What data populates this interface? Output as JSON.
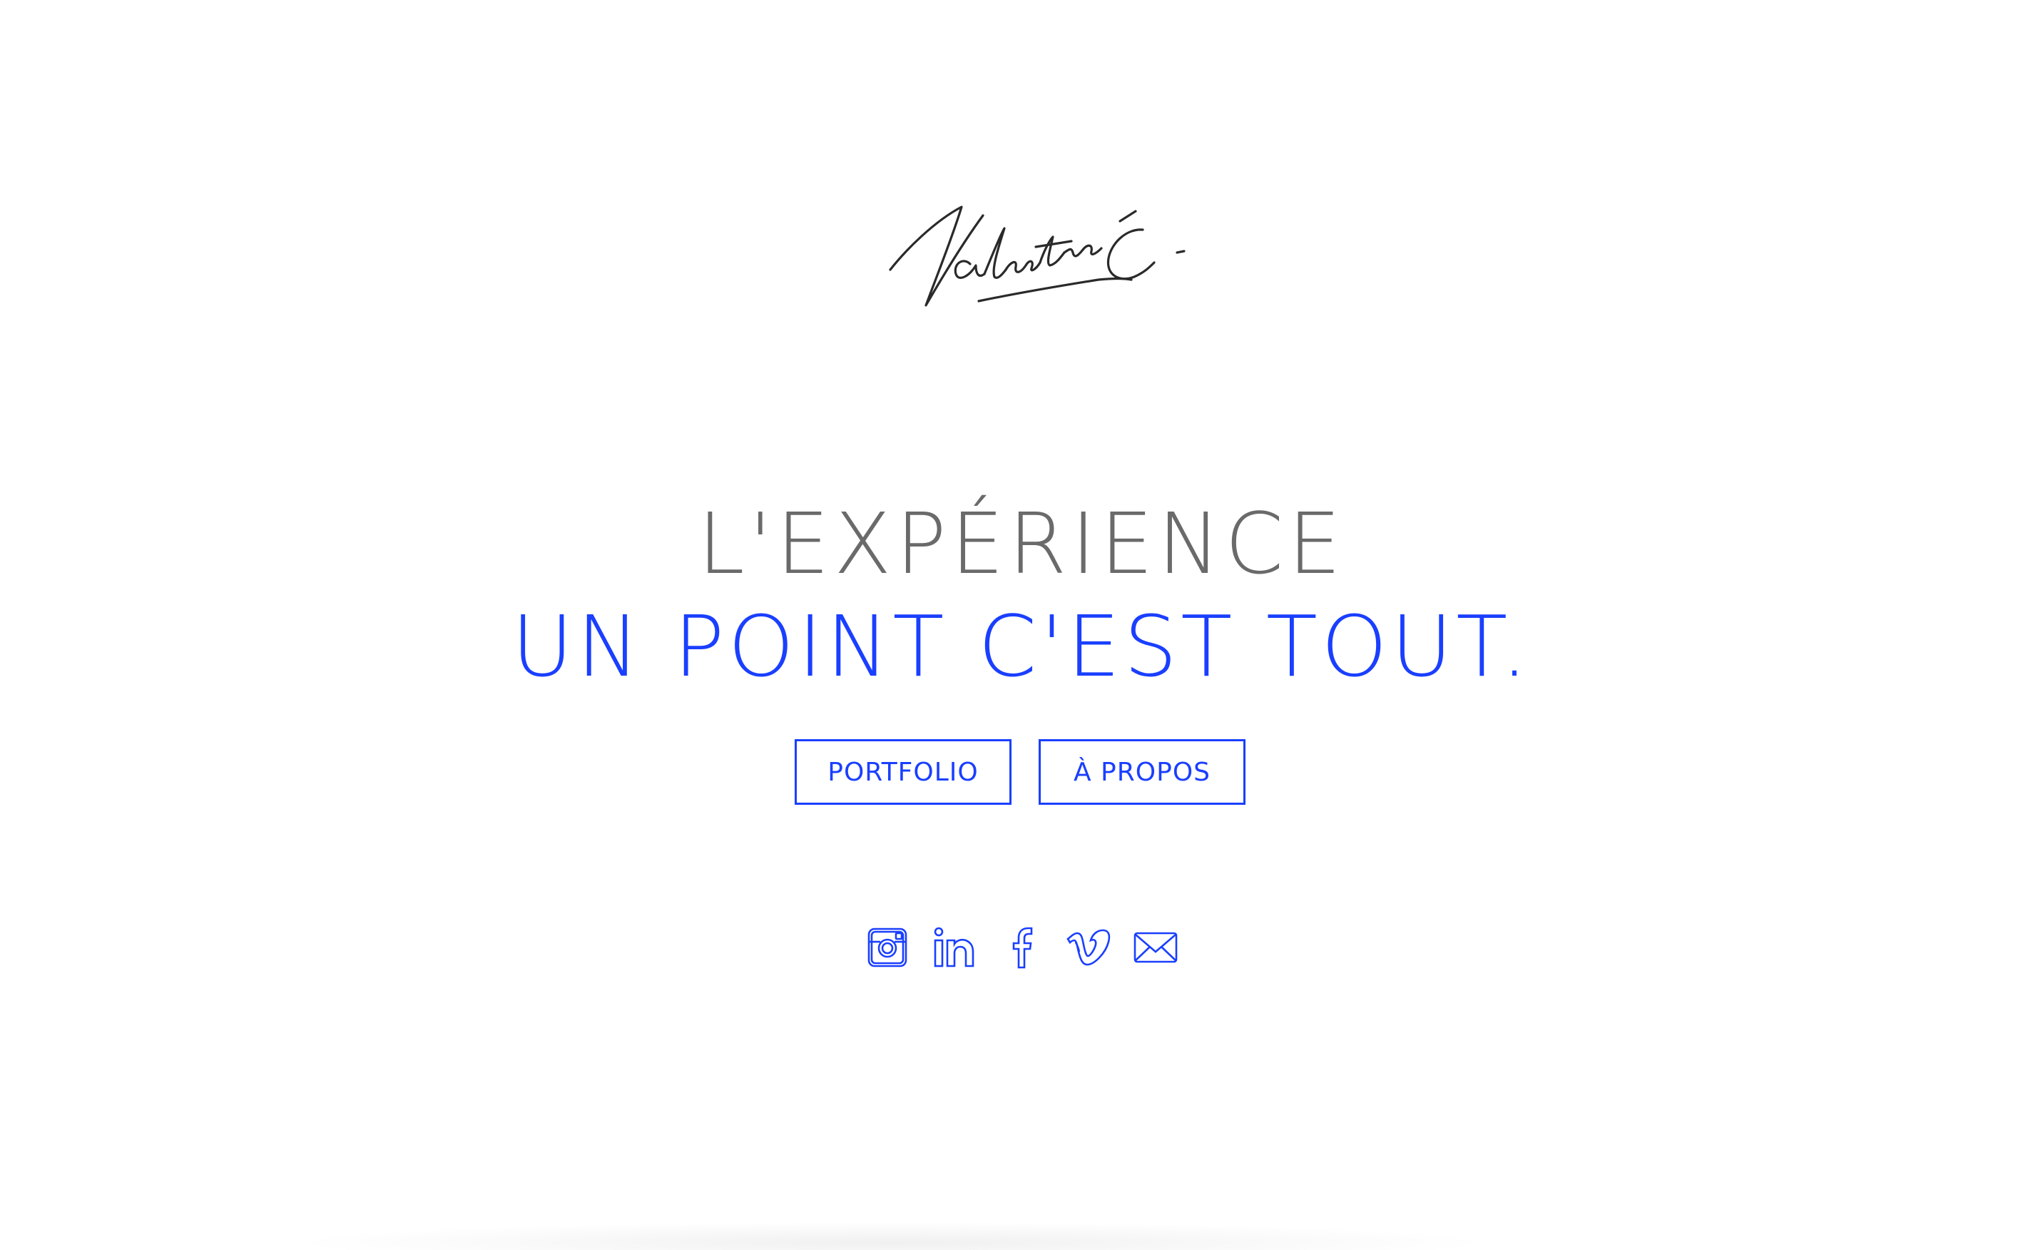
{
  "header": {
    "signature_logo": "Valentin C."
  },
  "hero": {
    "line1": "L'EXPÉRIENCE",
    "line2": "UN POINT C'EST TOUT."
  },
  "nav": {
    "portfolio_label": "PORTFOLIO",
    "apropos_label": "À PROPOS"
  },
  "social": {
    "icons": [
      "instagram-icon",
      "linkedin-icon",
      "facebook-icon",
      "vimeo-icon",
      "mail-icon"
    ]
  },
  "colors": {
    "accent": "#1a3fff",
    "headline_gray": "#6a6a6a",
    "background": "#ffffff",
    "signature_ink": "#2a2a2a"
  }
}
